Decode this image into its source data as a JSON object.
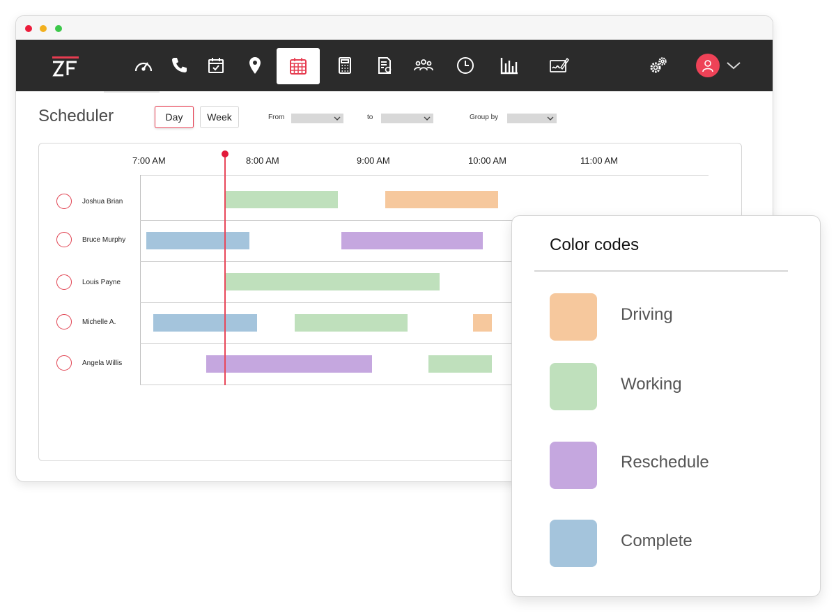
{
  "navbar": {
    "logo_text": "ZF",
    "icons": [
      "dashboard-gauge-icon",
      "phone-icon",
      "calendar-check-icon",
      "location-pin-icon",
      "calendar-grid-icon",
      "calculator-icon",
      "invoice-icon",
      "people-group-icon",
      "clock-icon",
      "bar-chart-icon",
      "contract-sign-icon"
    ],
    "active_icon": "calendar-grid-icon",
    "settings_icon": "gears-icon",
    "avatar_icon": "user-avatar-icon"
  },
  "scheduler": {
    "title": "Scheduler",
    "views": [
      "Day",
      "Week"
    ],
    "active_view": "Day",
    "filters": {
      "from_label": "From",
      "to_label": "to",
      "group_by_label": "Group by"
    },
    "time_labels": [
      "7:00 AM",
      "8:00 AM",
      "9:00 AM",
      "10:00 AM",
      "11:00 AM"
    ],
    "current_time": "7:50 AM",
    "rows": [
      {
        "name": "Joshua Brian",
        "bars": [
          {
            "status": "Working",
            "start": "7:50",
            "end": "8:50"
          },
          {
            "status": "Driving",
            "start": "9:15",
            "end": "10:15"
          }
        ]
      },
      {
        "name": "Bruce Murphy",
        "bars": [
          {
            "status": "Complete",
            "start": "7:08",
            "end": "8:03"
          },
          {
            "status": "Reschedule",
            "start": "8:52",
            "end": "10:07"
          }
        ]
      },
      {
        "name": "Louis Payne",
        "bars": [
          {
            "status": "Working",
            "start": "7:50",
            "end": "9:44"
          }
        ]
      },
      {
        "name": "Michelle A.",
        "bars": [
          {
            "status": "Complete",
            "start": "7:12",
            "end": "8:07"
          },
          {
            "status": "Working",
            "start": "8:27",
            "end": "9:27"
          },
          {
            "status": "Driving",
            "start": "10:02",
            "end": "10:12"
          }
        ]
      },
      {
        "name": "Angela Willis",
        "bars": [
          {
            "status": "Reschedule",
            "start": "7:40",
            "end": "9:08"
          },
          {
            "status": "Working",
            "start": "9:38",
            "end": "10:12"
          }
        ]
      }
    ]
  },
  "legend": {
    "title": "Color codes",
    "items": [
      {
        "label": "Driving",
        "color": "#f6c89d"
      },
      {
        "label": "Working",
        "color": "#bfe0bc"
      },
      {
        "label": "Reschedule",
        "color": "#c5a7df"
      },
      {
        "label": "Complete",
        "color": "#a4c4dc"
      }
    ]
  },
  "colors": {
    "accent": "#e63c50",
    "navbar": "#2b2b2b"
  }
}
